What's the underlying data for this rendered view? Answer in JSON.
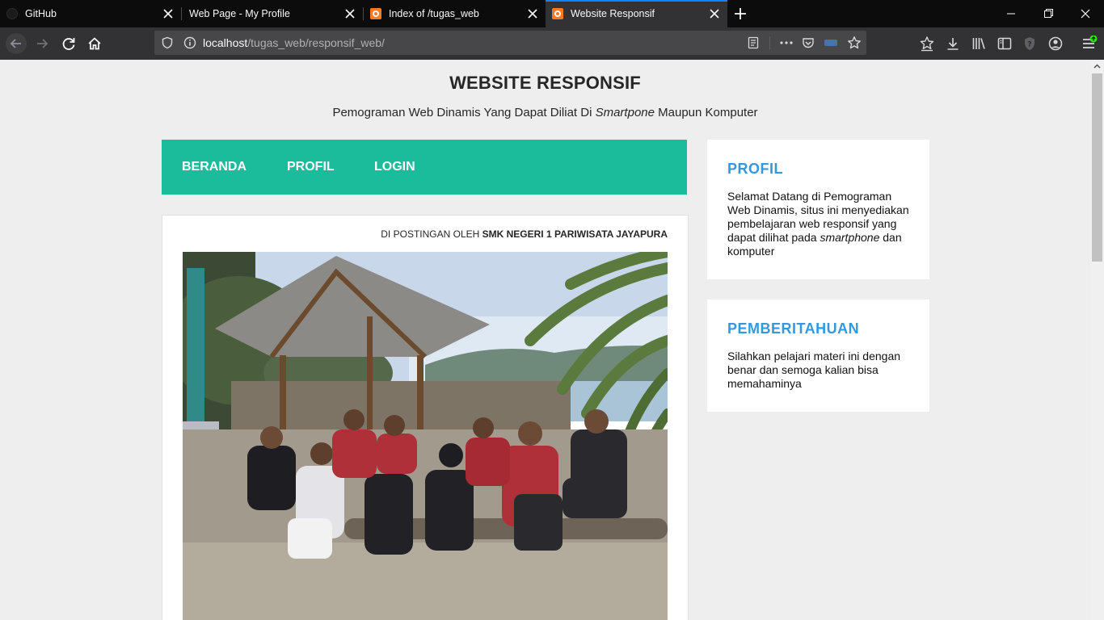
{
  "browser": {
    "tabs": [
      {
        "title": "GitHub",
        "favicon": "github-icon",
        "active": false
      },
      {
        "title": "Web Page - My Profile",
        "favicon": "",
        "active": false
      },
      {
        "title": "Index of /tugas_web",
        "favicon": "xampp-icon",
        "active": false
      },
      {
        "title": "Website Responsif",
        "favicon": "xampp-icon",
        "active": true
      }
    ],
    "url": {
      "host": "localhost",
      "path": "/tugas_web/responsif_web/"
    },
    "accent_color": "#0a84ff"
  },
  "site": {
    "title": "WEBSITE RESPONSIF",
    "description_before": "Pemograman Web Dinamis Yang Dapat Diliat Di ",
    "description_italic": "Smartpone",
    "description_after": " Maupun Komputer"
  },
  "menu": {
    "color": "#1abc9c",
    "items": [
      {
        "label": "BERANDA"
      },
      {
        "label": "PROFIL"
      },
      {
        "label": "LOGIN"
      }
    ]
  },
  "post": {
    "meta_prefix": "DI POSTINGAN OLEH ",
    "author": "SMK NEGERI 1 PARIWISATA JAYAPURA"
  },
  "sidebar": {
    "title_color": "#3498db",
    "widgets": [
      {
        "title": "PROFIL",
        "text_before": "Selamat Datang di Pemograman Web Dinamis, situs ini menyediakan pembelajaran web responsif yang dapat dilihat pada ",
        "text_italic": "smartphone",
        "text_after": " dan komputer"
      },
      {
        "title": "PEMBERITAHUAN",
        "text_before": "Silahkan pelajari materi ini dengan benar dan semoga kalian bisa memahaminya",
        "text_italic": "",
        "text_after": ""
      }
    ]
  }
}
